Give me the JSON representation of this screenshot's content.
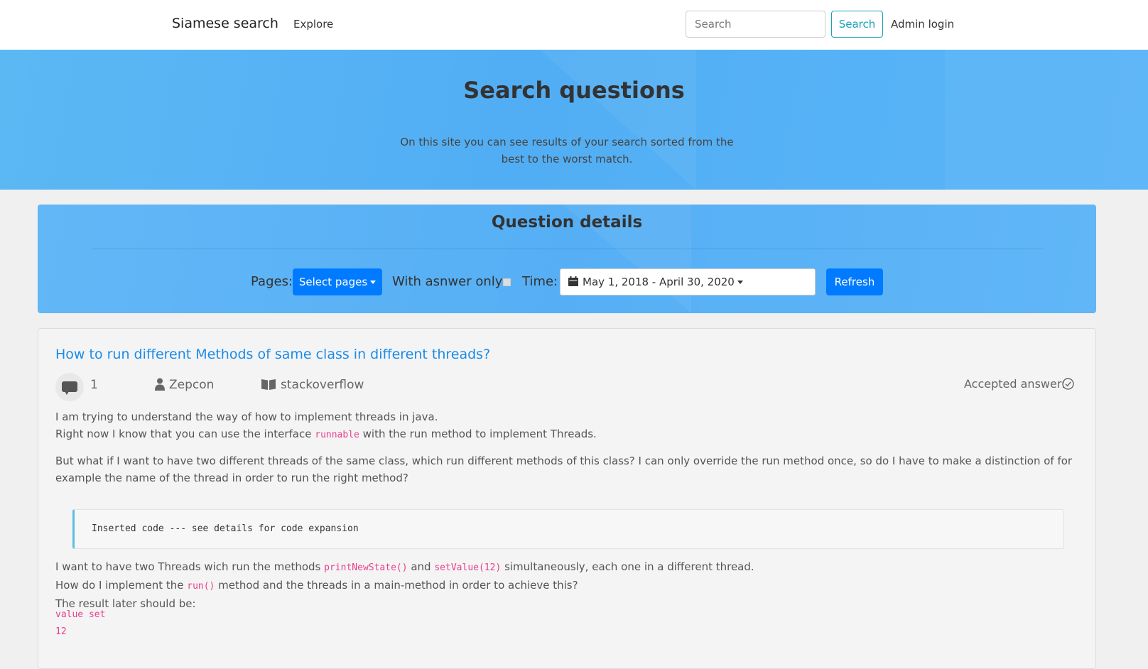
{
  "navbar": {
    "brand": "Siamese search",
    "explore": "Explore",
    "search_placeholder": "Search",
    "search_button": "Search",
    "admin_login": "Admin login"
  },
  "hero": {
    "title": "Search questions",
    "subtitle": "On this site you can see results of your search sorted from the best to the worst match."
  },
  "details": {
    "title": "Question details",
    "pages_label": "Pages:",
    "select_pages_button": "Select pages",
    "answer_only_label": "With asnwer only:",
    "answer_only_checked": false,
    "time_label": "Time:",
    "date_range": "May 1, 2018 - April 30, 2020",
    "refresh_button": "Refresh"
  },
  "question": {
    "title": "How to run different Methods of same class in different threads?",
    "comment_count": "1",
    "author": "Zepcon",
    "source": "stackoverflow",
    "accepted_answer_label": "Accepted answer:",
    "p1_line1": "I am trying to understand the way of how to implement threads in java.",
    "p1_line2_a": "Right now I know that you can use the interface",
    "p1_code": "runnable",
    "p1_line2_b": "with the run method to implement Threads.",
    "p2": "But what if I want to have two different threads of the same class, which run different methods of this class? I can only override the run method once, so do I have to make a distinction of for example the name of the thread in order to run the right method?",
    "code_block": "Inserted code --- see details for code expansion",
    "p3_a": "I want to have two Threads wich run the methods",
    "p3_code1": "printNewState()",
    "p3_and": "and",
    "p3_code2": "setValue(12)",
    "p3_b": "simultaneously, each one in a different thread.",
    "p4_a": "How do I implement the",
    "p4_code": "run()",
    "p4_b": "method and the threads in a main-method in order to achieve this?",
    "p5": "The result later should be:",
    "output_line1": "value set",
    "output_line2": "12"
  },
  "colors": {
    "primary": "#007bff",
    "info": "#17a2b8",
    "hero_blue": "#52aef4",
    "link": "#1a8be8",
    "code_pink": "#e83e8c"
  }
}
